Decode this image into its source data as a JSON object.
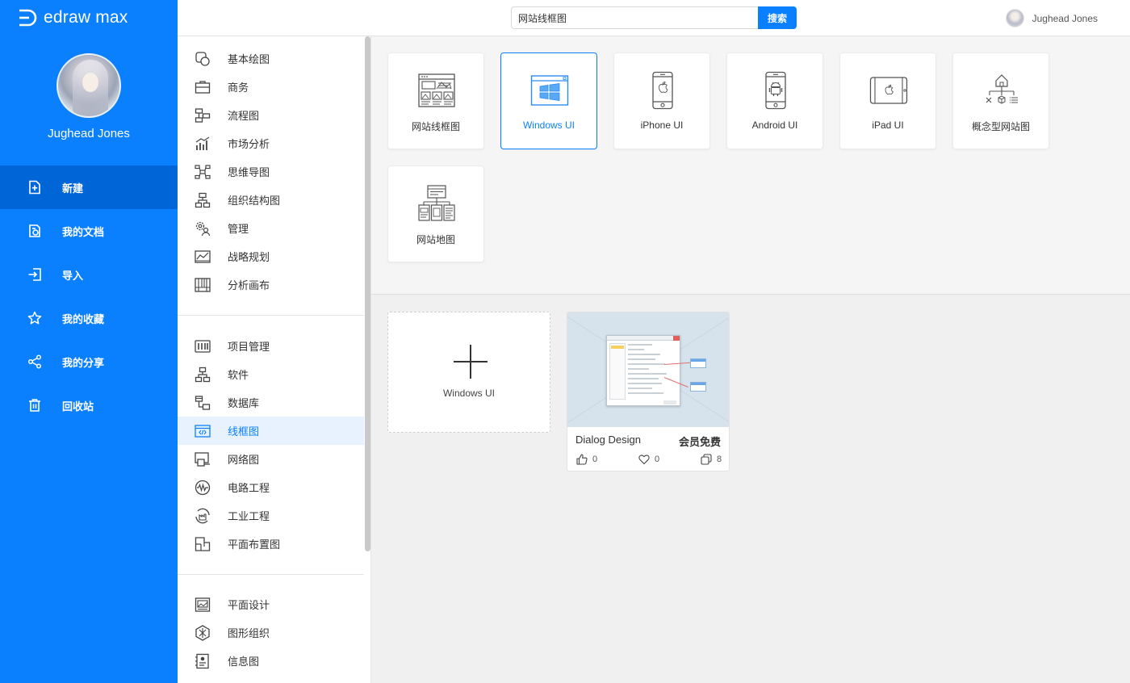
{
  "app": {
    "logo_text": "edraw max"
  },
  "user": {
    "name": "Jughead Jones"
  },
  "sidebar": {
    "items": [
      {
        "label": "新建",
        "icon": "new-file-icon",
        "active": true
      },
      {
        "label": "我的文档",
        "icon": "documents-icon",
        "active": false
      },
      {
        "label": "导入",
        "icon": "import-icon",
        "active": false
      },
      {
        "label": "我的收藏",
        "icon": "star-icon",
        "active": false
      },
      {
        "label": "我的分享",
        "icon": "share-icon",
        "active": false
      },
      {
        "label": "回收站",
        "icon": "trash-icon",
        "active": false
      }
    ]
  },
  "search": {
    "value": "网站线框图",
    "button_label": "搜索"
  },
  "categories": {
    "group1": [
      {
        "label": "基本绘图",
        "icon": "basic-shapes-icon"
      },
      {
        "label": "商务",
        "icon": "briefcase-icon"
      },
      {
        "label": "流程图",
        "icon": "flowchart-icon"
      },
      {
        "label": "市场分析",
        "icon": "bar-chart-icon"
      },
      {
        "label": "思维导图",
        "icon": "mindmap-icon"
      },
      {
        "label": "组织结构图",
        "icon": "org-chart-icon"
      },
      {
        "label": "管理",
        "icon": "management-icon"
      },
      {
        "label": "战略规划",
        "icon": "strategy-icon"
      },
      {
        "label": "分析画布",
        "icon": "canvas-icon"
      }
    ],
    "group2": [
      {
        "label": "项目管理",
        "icon": "project-icon"
      },
      {
        "label": "软件",
        "icon": "software-icon"
      },
      {
        "label": "数据库",
        "icon": "database-icon"
      },
      {
        "label": "线框图",
        "icon": "wireframe-icon",
        "active": true
      },
      {
        "label": "网络图",
        "icon": "network-icon"
      },
      {
        "label": "电路工程",
        "icon": "circuit-icon"
      },
      {
        "label": "工业工程",
        "icon": "industrial-icon"
      },
      {
        "label": "平面布置图",
        "icon": "floorplan-icon"
      }
    ],
    "group3": [
      {
        "label": "平面设计",
        "icon": "graphic-design-icon"
      },
      {
        "label": "图形组织",
        "icon": "graphic-organizer-icon"
      },
      {
        "label": "信息图",
        "icon": "infographic-icon"
      }
    ]
  },
  "template_types": [
    {
      "label": "网站线框图",
      "icon": "website-wireframe-icon",
      "active": false
    },
    {
      "label": "Windows UI",
      "icon": "windows-ui-icon",
      "active": true
    },
    {
      "label": "iPhone UI",
      "icon": "iphone-icon",
      "active": false
    },
    {
      "label": "Android UI",
      "icon": "android-icon",
      "active": false
    },
    {
      "label": "iPad UI",
      "icon": "ipad-icon",
      "active": false
    },
    {
      "label": "概念型网站图",
      "icon": "concept-sitemap-icon",
      "active": false
    },
    {
      "label": "网站地图",
      "icon": "sitemap-icon",
      "active": false
    }
  ],
  "new_template": {
    "label": "Windows UI"
  },
  "templates": [
    {
      "title": "Dialog Design",
      "badge": "会员免费",
      "likes": "0",
      "favorites": "0",
      "copies": "8"
    }
  ]
}
